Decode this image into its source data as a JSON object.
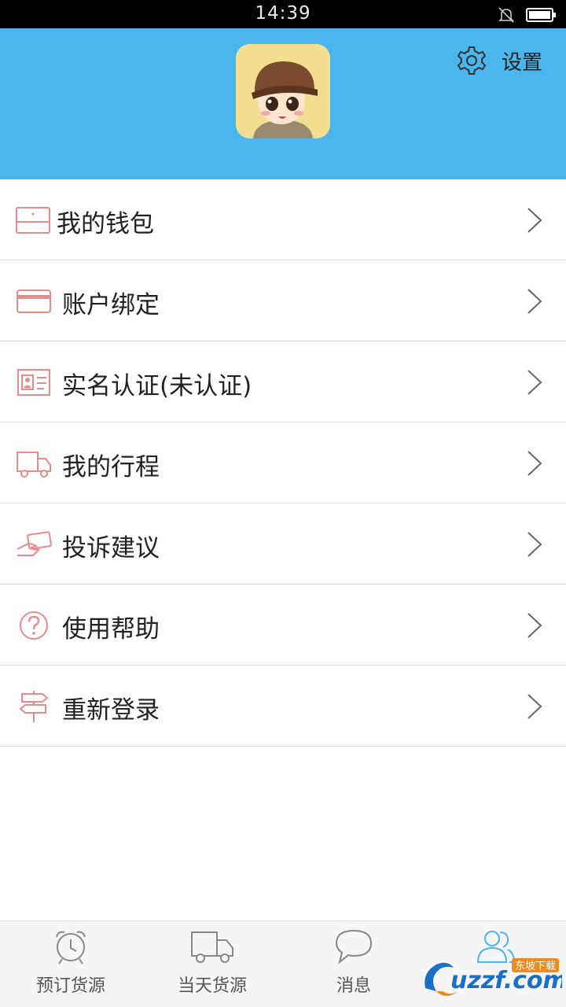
{
  "status_bar": {
    "time": "14:39"
  },
  "header": {
    "settings_label": "设置"
  },
  "menu": [
    {
      "label": "我的钱包",
      "icon": "wallet-icon"
    },
    {
      "label": "账户绑定",
      "icon": "card-icon"
    },
    {
      "label": "实名认证(未认证)",
      "icon": "id-card-icon"
    },
    {
      "label": "我的行程",
      "icon": "truck-icon"
    },
    {
      "label": "投诉建议",
      "icon": "hand-card-icon"
    },
    {
      "label": "使用帮助",
      "icon": "help-icon"
    },
    {
      "label": "重新登录",
      "icon": "signpost-icon"
    }
  ],
  "bottom_nav": [
    {
      "label": "预订货源",
      "icon": "alarm-clock-icon"
    },
    {
      "label": "当天货源",
      "icon": "truck-icon"
    },
    {
      "label": "消息",
      "icon": "chat-bubble-icon"
    },
    {
      "label": "",
      "icon": "users-icon",
      "active": true
    }
  ],
  "watermark": {
    "brand": "uzzf.com",
    "tag": "东坡下载"
  },
  "colors": {
    "header_bg": "#4bb6ee",
    "icon_accent": "#e88b8b",
    "nav_active": "#4bb6ee"
  }
}
